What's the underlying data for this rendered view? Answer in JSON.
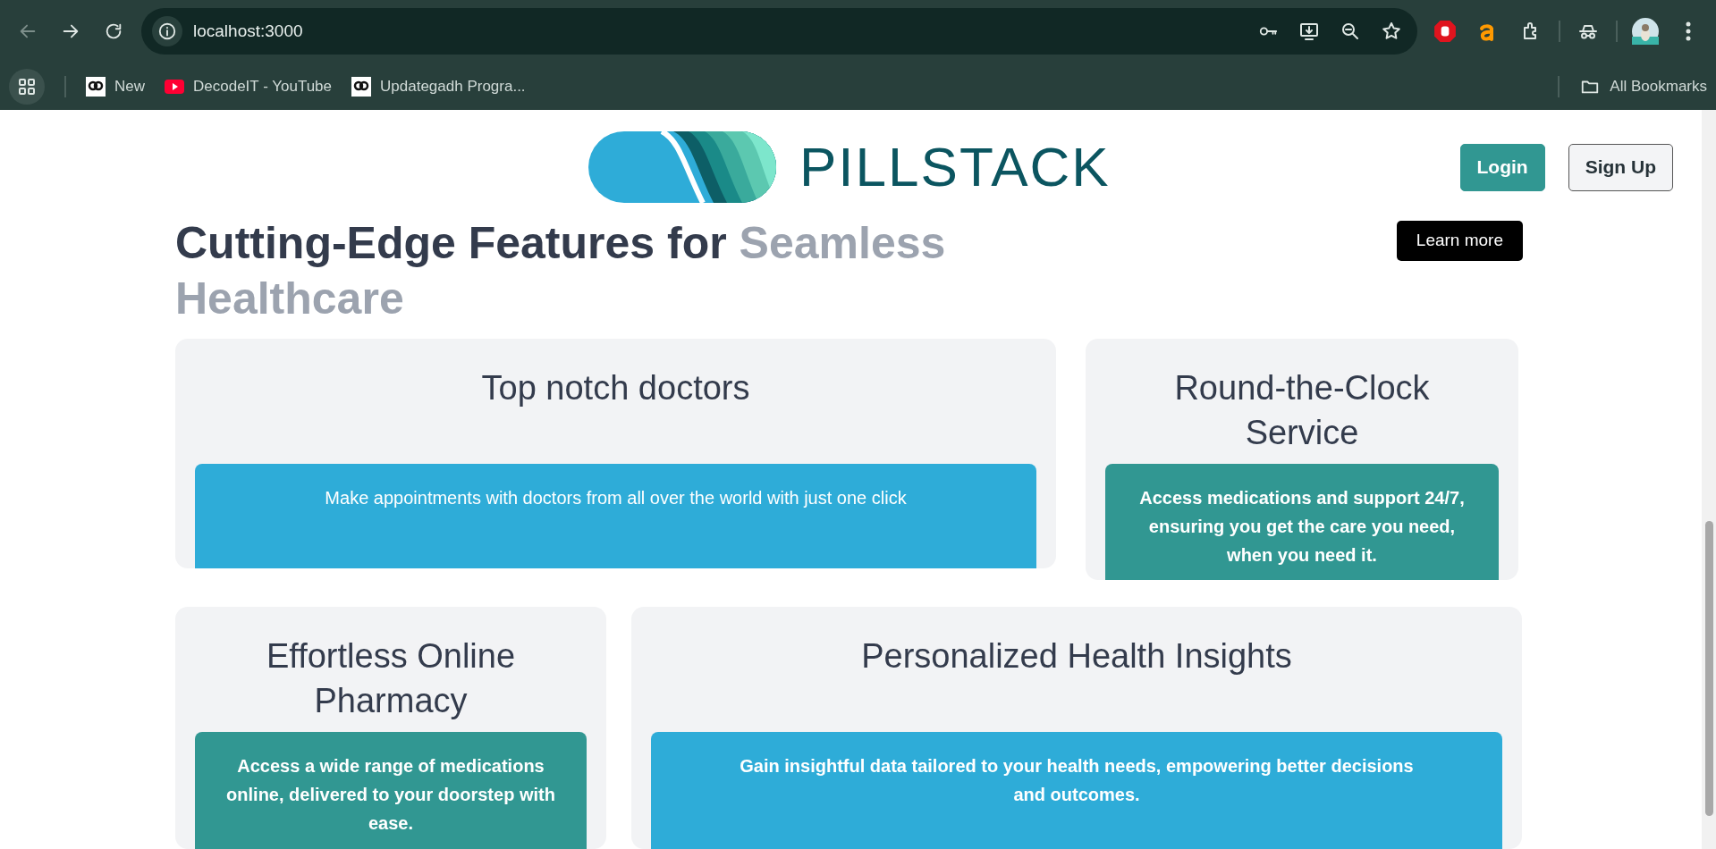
{
  "browser": {
    "url": "localhost:3000",
    "bookmarks": [
      {
        "label": "New",
        "kind": "ug"
      },
      {
        "label": "DecodeIT - YouTube",
        "kind": "youtube"
      },
      {
        "label": "Updategadh Progra...",
        "kind": "ug"
      }
    ],
    "all_bookmarks": "All Bookmarks"
  },
  "header": {
    "brand": "PILLSTACK",
    "buttons": [
      {
        "label": "Login",
        "kind": "primary"
      },
      {
        "label": "Sign Up",
        "kind": "outline"
      }
    ]
  },
  "heading": {
    "main": "Cutting-Edge Features for ",
    "highlight": "Seamless Healthcare"
  },
  "learn_more": "Learn more",
  "features": [
    {
      "title": "Top notch doctors",
      "description": "Make appointments with doctors from all over the world with just one click",
      "color": "#2eacd8"
    },
    {
      "title": "Round-the-Clock Service",
      "description": "Access medications and support 24/7, ensuring you get the care you need, when you need it.",
      "color": "#319792"
    },
    {
      "title": "Effortless Online Pharmacy",
      "description": "Access a wide range of medications online, delivered to your doorstep with ease.",
      "color": "#319792"
    },
    {
      "title": "Personalized Health Insights",
      "description": "Gain insightful data tailored to your health needs, empowering better decisions and outcomes.",
      "color": "#2eacd8"
    }
  ]
}
